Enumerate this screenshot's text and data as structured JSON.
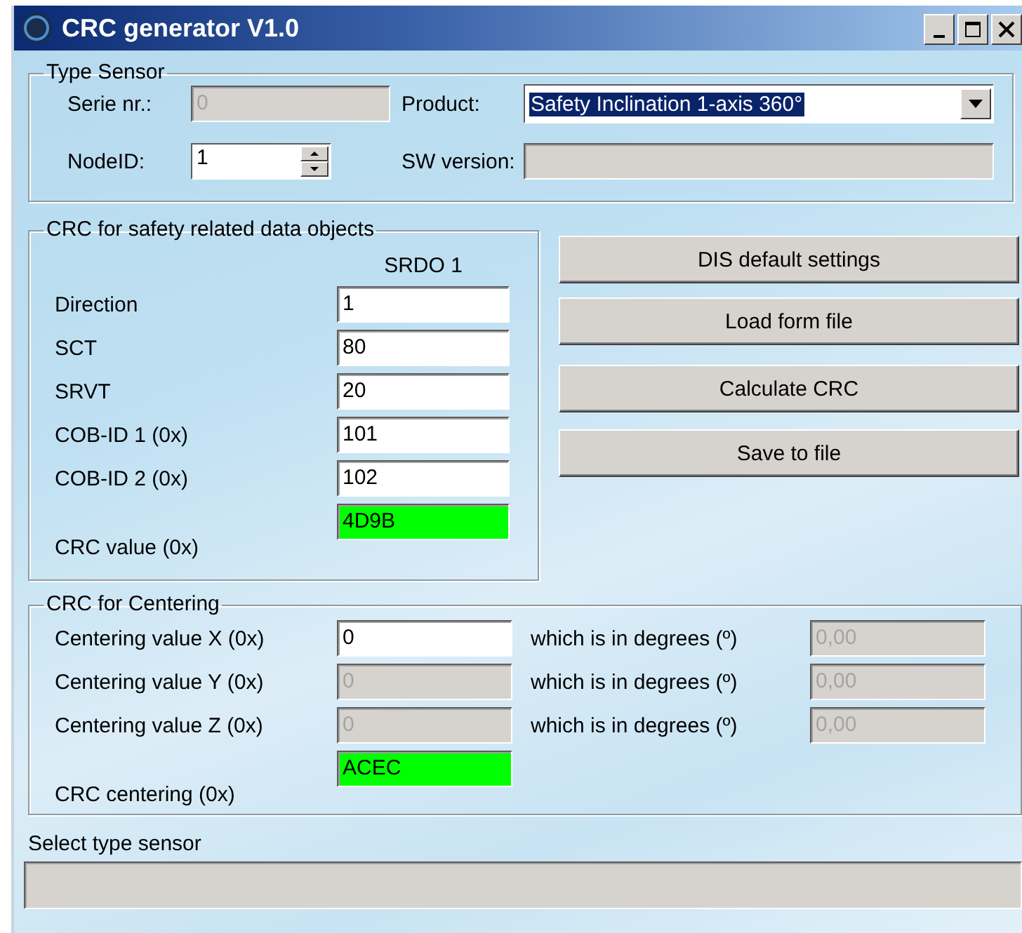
{
  "window": {
    "title": "CRC generator V1.0",
    "buttons": [
      {
        "kind": "minimize"
      },
      {
        "kind": "maximize"
      },
      {
        "kind": "close"
      }
    ]
  },
  "type_sensor": {
    "title": "Type Sensor",
    "serie_nr": {
      "label": "Serie nr.:",
      "value": "0",
      "disabled": true
    },
    "product": {
      "label": "Product:",
      "value": "Safety Inclination 1-axis 360°",
      "highlighted": true
    },
    "node_id": {
      "label": "NodeID:",
      "value": "1"
    },
    "sw_version": {
      "label": "SW version:",
      "disabled": true
    }
  },
  "safety_crc": {
    "title": "CRC for safety related data objects",
    "column": "SRDO 1",
    "rows": [
      {
        "label": "Direction",
        "value": "1",
        "disabled": false
      },
      {
        "label": "SCT",
        "value": "80",
        "disabled": false
      },
      {
        "label": "SRVT",
        "value": "20",
        "disabled": false
      },
      {
        "label": "COB-ID 1 (0x)",
        "value": "101",
        "disabled": false
      },
      {
        "label": "COB-ID 2 (0x)",
        "value": "102",
        "disabled": false
      },
      {
        "label": "CRC value (0x)",
        "value": "4D9B",
        "disabled": false,
        "color": "#00ff00"
      }
    ]
  },
  "buttons": [
    {
      "label": "DIS default settings"
    },
    {
      "label": "Load form file"
    },
    {
      "label": "Calculate CRC"
    },
    {
      "label": "Save to file"
    }
  ],
  "centering": {
    "title": "CRC for Centering",
    "rows": [
      {
        "label": "Centering value X (0x)",
        "value": "0",
        "disabled": false,
        "degrees_label": "which is in degrees (º)",
        "degrees": {
          "value": "0,00",
          "disabled": true
        }
      },
      {
        "label": "Centering value Y (0x)",
        "value": "0",
        "disabled": true,
        "degrees_label": "which is in degrees (º)",
        "degrees": {
          "value": "0,00",
          "disabled": true
        }
      },
      {
        "label": "Centering value Z (0x)",
        "value": "0",
        "disabled": true,
        "degrees_label": "which is in degrees (º)",
        "degrees": {
          "value": "0,00",
          "disabled": true
        }
      }
    ],
    "crc": {
      "label": "CRC centering (0x)",
      "value": "ACEC",
      "color": "#00ff00"
    }
  },
  "status": {
    "label": "Select type sensor",
    "disabled": true
  }
}
